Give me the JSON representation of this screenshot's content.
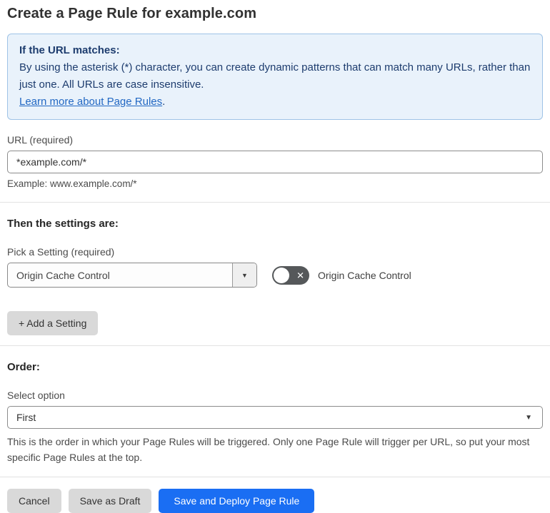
{
  "page": {
    "title": "Create a Page Rule for example.com"
  },
  "info_box": {
    "heading": "If the URL matches:",
    "body": "By using the asterisk (*) character, you can create dynamic patterns that can match many URLs, rather than just one. All URLs are case insensitive.",
    "link_label": "Learn more about Page Rules",
    "link_suffix": "."
  },
  "url_section": {
    "label": "URL (required)",
    "value": "*example.com/*",
    "example": "Example: www.example.com/*"
  },
  "settings_section": {
    "heading": "Then the settings are:",
    "picker_label": "Pick a Setting (required)",
    "picker_value": "Origin Cache Control",
    "toggle_state": "off",
    "toggle_label": "Origin Cache Control",
    "add_setting_label": "+ Add a Setting"
  },
  "order_section": {
    "heading": "Order:",
    "select_label": "Select option",
    "select_value": "First",
    "help_text": "This is the order in which your Page Rules will be triggered. Only one Page Rule will trigger per URL, so put your most specific Page Rules at the top."
  },
  "actions": {
    "cancel_label": "Cancel",
    "save_draft_label": "Save as Draft",
    "save_deploy_label": "Save and Deploy Page Rule"
  },
  "icons": {
    "dropdown_arrow": "▼",
    "toggle_x": "✕"
  },
  "colors": {
    "accent_blue": "#1a6ef3",
    "info_bg": "#e9f2fb",
    "info_border": "#9fc3e6",
    "info_text": "#1d3c6e",
    "link_blue": "#2268c3",
    "toggle_off_bg": "#55585a"
  }
}
